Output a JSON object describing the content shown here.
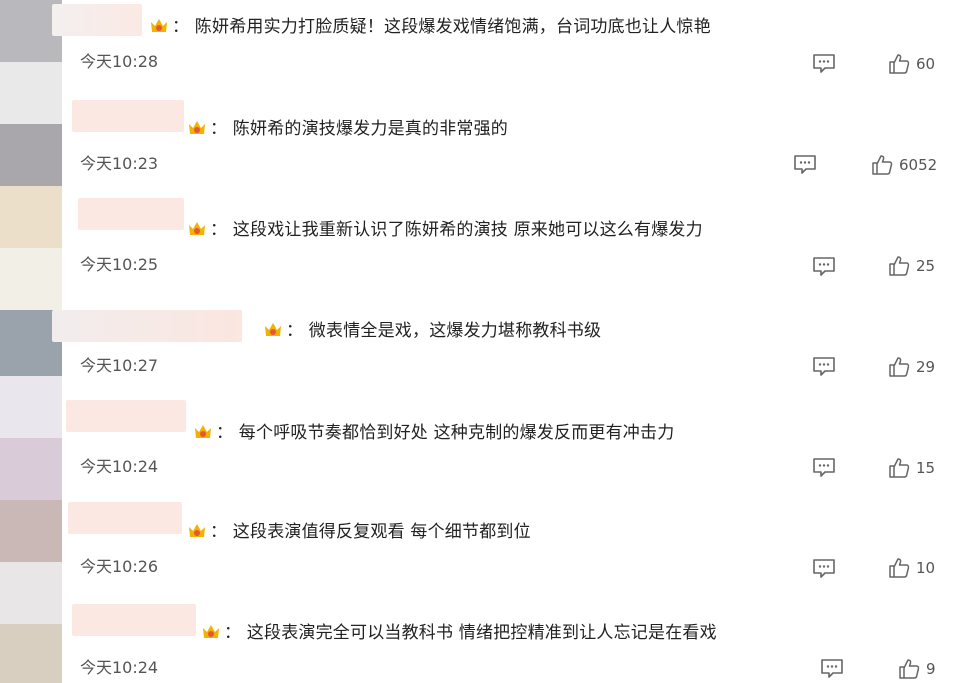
{
  "comments": [
    {
      "text": "：  陈妍希用实力打脸质疑！这段爆发戏情绪饱满，台词功底也让人惊艳",
      "time": "今天10:28",
      "likes": "60"
    },
    {
      "text": "：  陈妍希的演技爆发力是真的非常强的",
      "time": "今天10:23",
      "likes": "6052"
    },
    {
      "text": "：  这段戏让我重新认识了陈妍希的演技 原来她可以这么有爆发力",
      "time": "今天10:25",
      "likes": "25"
    },
    {
      "text": "：  微表情全是戏，这爆发力堪称教科书级",
      "time": "今天10:27",
      "likes": "29"
    },
    {
      "text": "：  每个呼吸节奏都恰到好处 这种克制的爆发反而更有冲击力",
      "time": "今天10:24",
      "likes": "15"
    },
    {
      "text": "：  这段表演值得反复观看 每个细节都到位",
      "time": "今天10:26",
      "likes": "10"
    },
    {
      "text": "：  这段表演完全可以当教科书 情绪把控精准到让人忘记是在看戏",
      "time": "今天10:24",
      "likes": "9"
    }
  ],
  "icons": {
    "badge": "crown-badge-icon",
    "reply": "comment-icon",
    "like": "thumbs-up-icon"
  },
  "colors": {
    "badge_gold": "#f2b300",
    "badge_red": "#e8553a",
    "name_blur": "#fbe7e2",
    "icon_gray": "#666666"
  }
}
